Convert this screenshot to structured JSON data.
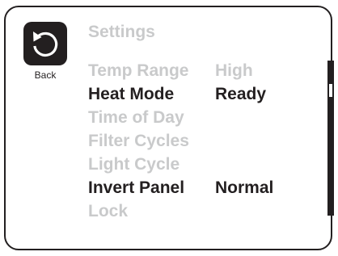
{
  "header": {
    "back_label": "Back",
    "back_icon": "back-arrow-icon",
    "title": "Settings"
  },
  "menu": {
    "items": [
      {
        "label": "Temp Range",
        "value": "High",
        "enabled": false
      },
      {
        "label": "Heat Mode",
        "value": "Ready",
        "enabled": true
      },
      {
        "label": "Time of Day",
        "value": "",
        "enabled": false
      },
      {
        "label": "Filter Cycles",
        "value": "",
        "enabled": false
      },
      {
        "label": "Light Cycle",
        "value": "",
        "enabled": false
      },
      {
        "label": "Invert Panel",
        "value": "Normal",
        "enabled": true
      },
      {
        "label": "Lock",
        "value": "",
        "enabled": false
      }
    ]
  },
  "colors": {
    "enabled_text": "#231f20",
    "disabled_text": "#c9cacb",
    "frame": "#231f20"
  }
}
